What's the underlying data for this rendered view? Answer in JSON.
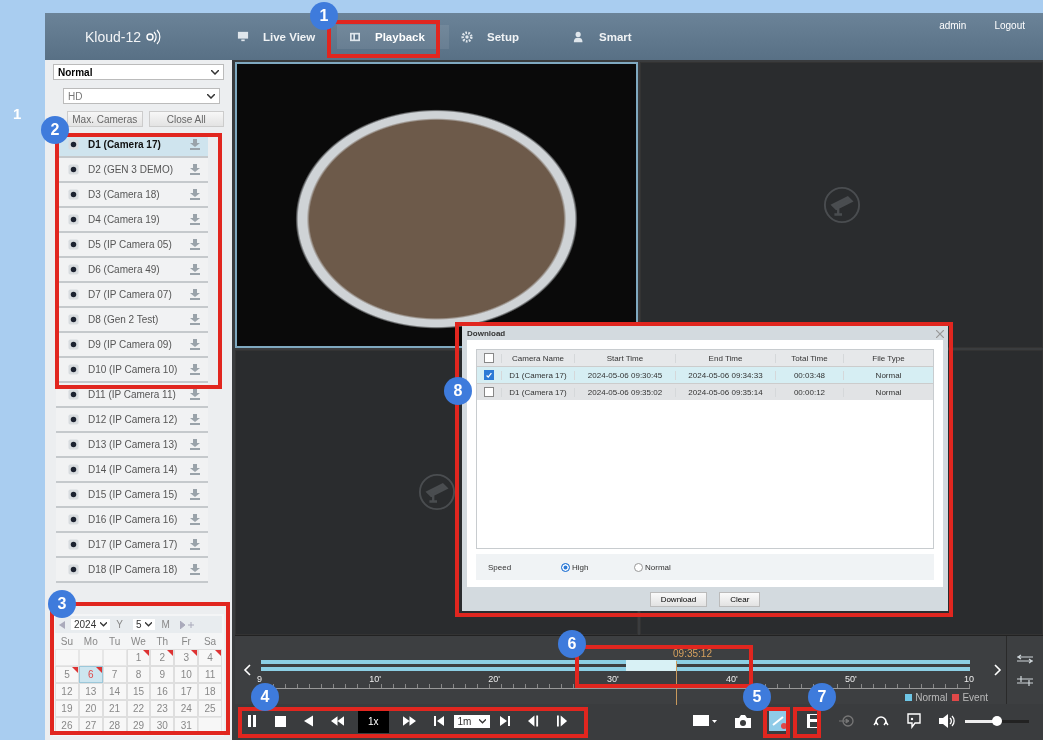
{
  "side_marker": "1",
  "header": {
    "logo": "Kloud-12",
    "nav": [
      {
        "kind": "monitor",
        "label": "Live View",
        "selected": false
      },
      {
        "kind": "film",
        "label": "Playback",
        "selected": true
      },
      {
        "kind": "gear",
        "label": "Setup",
        "selected": false
      },
      {
        "kind": "person",
        "label": "Smart",
        "selected": false
      }
    ],
    "user": "admin",
    "logout": "Logout"
  },
  "sidebar": {
    "stream": "Normal",
    "quality": "HD",
    "buttons": [
      "Max. Cameras",
      "Close All"
    ],
    "cameras": [
      {
        "name": "D1 (Camera 17)",
        "selected": true
      },
      {
        "name": "D2 (GEN 3 DEMO)",
        "selected": false
      },
      {
        "name": "D3 (Camera 18)",
        "selected": false
      },
      {
        "name": "D4 (Camera 19)",
        "selected": false
      },
      {
        "name": "D5 (IP Camera 05)",
        "selected": false
      },
      {
        "name": "D6 (Camera 49)",
        "selected": false
      },
      {
        "name": "D7 (IP Camera 07)",
        "selected": false
      },
      {
        "name": "D8 (Gen 2 Test)",
        "selected": false
      },
      {
        "name": "D9 (IP Camera 09)",
        "selected": false
      },
      {
        "name": "D10 (IP Camera 10)",
        "selected": false
      },
      {
        "name": "D11 (IP Camera 11)",
        "selected": false
      },
      {
        "name": "D12 (IP Camera 12)",
        "selected": false
      },
      {
        "name": "D13 (IP Camera 13)",
        "selected": false
      },
      {
        "name": "D14 (IP Camera 14)",
        "selected": false
      },
      {
        "name": "D15 (IP Camera 15)",
        "selected": false
      },
      {
        "name": "D16 (IP Camera 16)",
        "selected": false
      },
      {
        "name": "D17 (IP Camera 17)",
        "selected": false
      },
      {
        "name": "D18 (IP Camera 18)",
        "selected": false
      }
    ]
  },
  "calendar": {
    "year": "2024",
    "year_label": "Y",
    "month": "5",
    "month_label": "M",
    "weekdays": [
      "Su",
      "Mo",
      "Tu",
      "We",
      "Th",
      "Fr",
      "Sa"
    ],
    "weeks": [
      [
        {
          "kind": "blank"
        },
        {
          "kind": "blank"
        },
        {
          "kind": "blank"
        },
        {
          "kind": "day",
          "day": "1",
          "recorded": true,
          "selected": false
        },
        {
          "day": "2",
          "recorded": true,
          "selected": false
        },
        {
          "day": "3",
          "recorded": true,
          "selected": false
        },
        {
          "day": "4",
          "recorded": true,
          "selected": false
        }
      ],
      [
        {
          "day": "5",
          "recorded": true,
          "selected": false
        },
        {
          "day": "6",
          "recorded": true,
          "selected": true
        },
        {
          "day": "7",
          "recorded": false,
          "selected": false
        },
        {
          "day": "8",
          "recorded": false,
          "selected": false
        },
        {
          "day": "9",
          "recorded": false,
          "selected": false
        },
        {
          "day": "10",
          "recorded": false,
          "selected": false
        },
        {
          "day": "11",
          "recorded": false,
          "selected": false
        }
      ],
      [
        {
          "day": "12",
          "recorded": false,
          "selected": false
        },
        {
          "day": "13",
          "recorded": false,
          "selected": false
        },
        {
          "day": "14",
          "recorded": false,
          "selected": false
        },
        {
          "day": "15",
          "recorded": false,
          "selected": false
        },
        {
          "day": "16",
          "recorded": false,
          "selected": false
        },
        {
          "day": "17",
          "recorded": false,
          "selected": false
        },
        {
          "day": "18",
          "recorded": false,
          "selected": false
        }
      ],
      [
        {
          "day": "19",
          "recorded": false,
          "selected": false
        },
        {
          "day": "20",
          "recorded": false,
          "selected": false
        },
        {
          "day": "21",
          "recorded": false,
          "selected": false
        },
        {
          "day": "22",
          "recorded": false,
          "selected": false
        },
        {
          "day": "23",
          "recorded": false,
          "selected": false
        },
        {
          "day": "24",
          "recorded": false,
          "selected": false
        },
        {
          "day": "25",
          "recorded": false,
          "selected": false
        }
      ],
      [
        {
          "day": "26",
          "recorded": false,
          "selected": false
        },
        {
          "day": "27",
          "recorded": false,
          "selected": false
        },
        {
          "day": "28",
          "recorded": false,
          "selected": false
        },
        {
          "day": "29",
          "recorded": false,
          "selected": false
        },
        {
          "day": "30",
          "recorded": false,
          "selected": false
        },
        {
          "day": "31",
          "recorded": false,
          "selected": false
        },
        {
          "kind": "blank"
        }
      ]
    ]
  },
  "video_tiles": [
    {
      "kind": "video"
    },
    {
      "kind": "empty"
    },
    {
      "kind": "empty"
    },
    {
      "kind": "covered"
    }
  ],
  "download_dialog": {
    "title": "Download",
    "columns": [
      "Camera Name",
      "Start Time",
      "End Time",
      "Total Time",
      "File Type"
    ],
    "all_checked": false,
    "rows": [
      {
        "checked": true,
        "selected": true,
        "cells": [
          "D1 (Camera 17)",
          "2024-05-06 09:30:45",
          "2024-05-06 09:34:33",
          "00:03:48",
          "Normal"
        ]
      },
      {
        "checked": false,
        "selected": false,
        "cells": [
          "D1 (Camera 17)",
          "2024-05-06 09:35:02",
          "2024-05-06 09:35:14",
          "00:00:12",
          "Normal"
        ]
      }
    ],
    "speed_label": "Speed",
    "speed_options": [
      {
        "label": "High",
        "selected": true
      },
      {
        "label": "Normal",
        "selected": false
      }
    ],
    "buttons": [
      "Download",
      "Clear"
    ]
  },
  "timeline": {
    "current_time": "09:35:12",
    "scale": [
      "9",
      "10'",
      "20'",
      "30'",
      "40'",
      "50'",
      "10"
    ],
    "legend": [
      {
        "label": "Normal",
        "color": "#6ec6e6"
      },
      {
        "label": "Event",
        "color": "#e04848"
      }
    ]
  },
  "controls": {
    "speed": "1x",
    "step": "1m",
    "volume": {
      "level": 0.5
    }
  },
  "annotations": [
    "1",
    "2",
    "3",
    "4",
    "5",
    "6",
    "7",
    "8"
  ]
}
